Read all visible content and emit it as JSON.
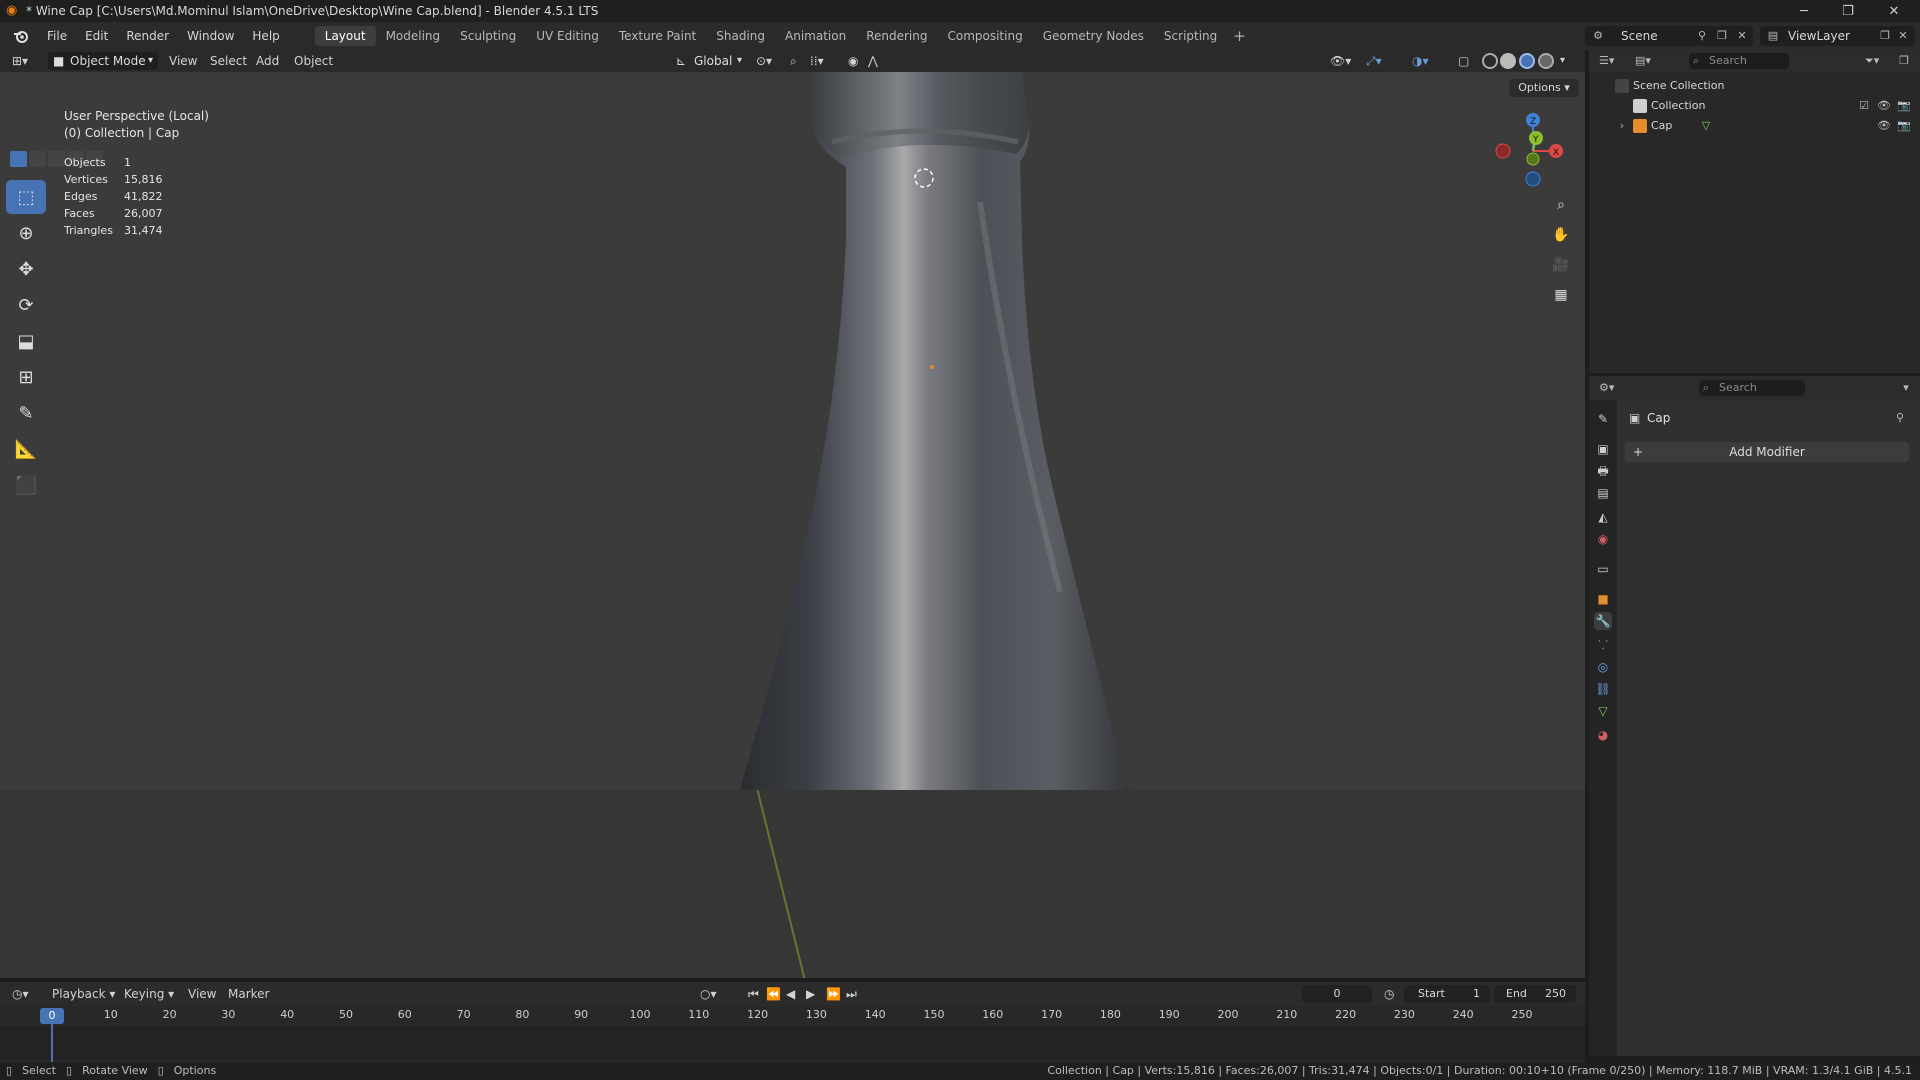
{
  "window": {
    "title": "* Wine Cap [C:\\Users\\Md.Mominul Islam\\OneDrive\\Desktop\\Wine Cap.blend] - Blender 4.5.1 LTS",
    "minimize": "─",
    "maximize": "❐",
    "close": "✕"
  },
  "menu": {
    "file": "File",
    "edit": "Edit",
    "render": "Render",
    "window": "Window",
    "help": "Help"
  },
  "workspaces": [
    "Layout",
    "Modeling",
    "Sculpting",
    "UV Editing",
    "Texture Paint",
    "Shading",
    "Animation",
    "Rendering",
    "Compositing",
    "Geometry Nodes",
    "Scripting"
  ],
  "workspace_add": "+",
  "scene": {
    "label": "Scene",
    "view_layer": "ViewLayer"
  },
  "viewport_header": {
    "mode": "Object Mode",
    "view": "View",
    "select": "Select",
    "add": "Add",
    "object": "Object",
    "orientation": "Global",
    "options": "Options"
  },
  "viewport": {
    "perspective": "User Perspective (Local)",
    "collection_info": "(0) Collection | Cap",
    "stats": [
      {
        "label": "Objects",
        "value": "1"
      },
      {
        "label": "Vertices",
        "value": "15,816"
      },
      {
        "label": "Edges",
        "value": "41,822"
      },
      {
        "label": "Faces",
        "value": "26,007"
      },
      {
        "label": "Triangles",
        "value": "31,474"
      }
    ],
    "gizmo": {
      "x": "X",
      "y": "Y",
      "z": "Z"
    }
  },
  "outliner": {
    "search_placeholder": "Search",
    "scene_collection": "Scene Collection",
    "collection": "Collection",
    "object": "Cap"
  },
  "properties": {
    "search_placeholder": "Search",
    "object_name": "Cap",
    "add_modifier": "Add Modifier"
  },
  "timeline": {
    "playback": "Playback",
    "keying": "Keying",
    "view": "View",
    "marker": "Marker",
    "current_frame": "0",
    "start_label": "Start",
    "start": "1",
    "end_label": "End",
    "end": "250",
    "ticks": [
      "10",
      "20",
      "30",
      "40",
      "50",
      "60",
      "70",
      "80",
      "90",
      "100",
      "110",
      "120",
      "130",
      "140",
      "150",
      "160",
      "170",
      "180",
      "190",
      "200",
      "210",
      "220",
      "230",
      "240",
      "250"
    ],
    "playhead": "0"
  },
  "statusbar": {
    "select": "Select",
    "rotate": "Rotate View",
    "options": "Options",
    "info": "Collection | Cap | Verts:15,816 | Faces:26,007 | Tris:31,474 | Objects:0/1 | Duration: 00:10+10 (Frame 0/250) | Memory: 118.7 MiB | VRAM: 1.3/4.1 GiB | 4.5.1"
  },
  "colors": {
    "accent": "#4772b3",
    "x_axis": "#e04848",
    "y_axis": "#8bbf2c",
    "z_axis": "#3d82d6"
  }
}
